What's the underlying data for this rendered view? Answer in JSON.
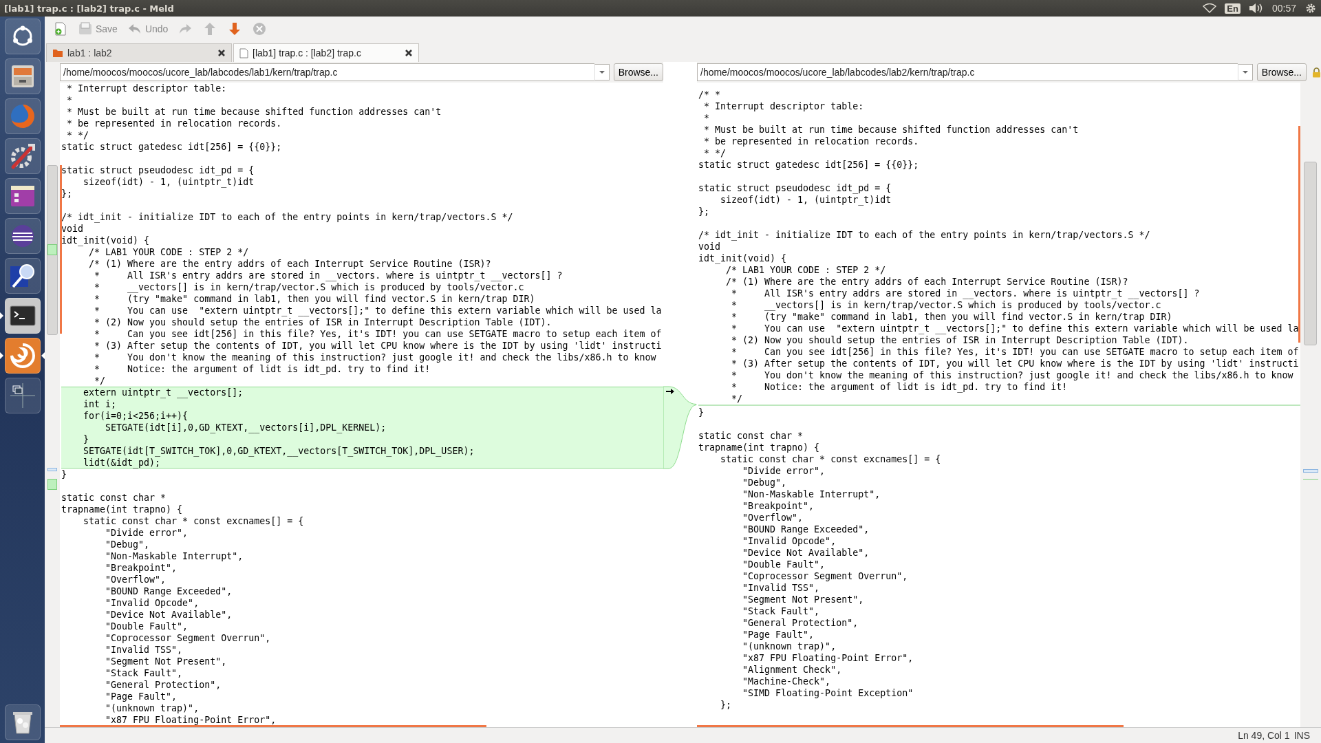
{
  "top_panel": {
    "title": "[lab1] trap.c : [lab2] trap.c - Meld",
    "keyboard": "En",
    "clock": "00:57"
  },
  "launcher": [
    {
      "kind": "dash",
      "running": false,
      "focused": false
    },
    {
      "kind": "files",
      "running": false,
      "focused": false
    },
    {
      "kind": "browser",
      "running": false,
      "focused": false
    },
    {
      "kind": "settings",
      "running": false,
      "focused": false
    },
    {
      "kind": "app",
      "running": false,
      "focused": false
    },
    {
      "kind": "sphere",
      "running": false,
      "focused": false
    },
    {
      "kind": "search",
      "running": false,
      "focused": false
    },
    {
      "kind": "terminal",
      "running": true,
      "focused": false
    },
    {
      "kind": "swirl",
      "running": true,
      "focused": true
    },
    {
      "kind": "workspaces",
      "running": false,
      "focused": false
    },
    {
      "kind": "trash",
      "running": false,
      "focused": false
    }
  ],
  "toolbar": [
    {
      "kind": "new",
      "disabled": false
    },
    {
      "kind": "save",
      "label": "Save",
      "disabled": true
    },
    {
      "kind": "undo",
      "label": "Undo",
      "disabled": true
    },
    {
      "kind": "redo",
      "disabled": true
    },
    {
      "kind": "up",
      "disabled": true
    },
    {
      "kind": "down",
      "disabled": false
    },
    {
      "kind": "stop",
      "disabled": true
    }
  ],
  "tabs": [
    {
      "label": "lab1 : lab2",
      "kind": "folder",
      "selected": false
    },
    {
      "label": "[lab1] trap.c : [lab2] trap.c",
      "kind": "file",
      "selected": true
    }
  ],
  "panes": [
    {
      "path": "/home/moocos/moocos/ucore_lab/labcodes/lab1/kern/trap/trap.c",
      "browse": "Browse...",
      "locked": false,
      "blocks": [
        {
          "kind": "context",
          "lines": [
            " * Interrupt descriptor table:",
            " *",
            " * Must be built at run time because shifted function addresses can't",
            " * be represented in relocation records.",
            " * */",
            "static struct gatedesc idt[256] = {{0}};"
          ]
        },
        {
          "kind": "blank"
        },
        {
          "kind": "context",
          "lines": [
            "static struct pseudodesc idt_pd = {",
            "    sizeof(idt) - 1, (uintptr_t)idt",
            "};"
          ]
        },
        {
          "kind": "blank"
        },
        {
          "kind": "context",
          "lines": [
            "/* idt_init - initialize IDT to each of the entry points in kern/trap/vectors.S */",
            "void",
            "idt_init(void) {",
            "     /* LAB1 YOUR CODE : STEP 2 */",
            "     /* (1) Where are the entry addrs of each Interrupt Service Routine (ISR)?",
            "      *     All ISR's entry addrs are stored in __vectors. where is uintptr_t __vectors[] ?",
            "      *     __vectors[] is in kern/trap/vector.S which is produced by tools/vector.c",
            "      *     (try \"make\" command in lab1, then you will find vector.S in kern/trap DIR)",
            "      *     You can use  \"extern uintptr_t __vectors[];\" to define this extern variable which will be used la",
            "      * (2) Now you should setup the entries of ISR in Interrupt Description Table (IDT).",
            "      *     Can you see idt[256] in this file? Yes, it's IDT! you can use SETGATE macro to setup each item of",
            "      * (3) After setup the contents of IDT, you will let CPU know where is the IDT by using 'lidt' instructi",
            "      *     You don't know the meaning of this instruction? just google it! and check the libs/x86.h to know",
            "      *     Notice: the argument of lidt is idt_pd. try to find it!",
            "      */"
          ]
        },
        {
          "kind": "inserted",
          "lines": [
            "    extern uintptr_t __vectors[];",
            "    int i;",
            "    for(i=0;i<256;i++){",
            "        SETGATE(idt[i],0,GD_KTEXT,__vectors[i],DPL_KERNEL);",
            "    }",
            "    SETGATE(idt[T_SWITCH_TOK],0,GD_KTEXT,__vectors[T_SWITCH_TOK],DPL_USER);",
            "    lidt(&idt_pd);"
          ]
        },
        {
          "kind": "context",
          "lines": [
            "}"
          ]
        },
        {
          "kind": "blank"
        },
        {
          "kind": "context",
          "lines": [
            "static const char *",
            "trapname(int trapno) {",
            "    static const char * const excnames[] = {",
            "        \"Divide error\",",
            "        \"Debug\",",
            "        \"Non-Maskable Interrupt\",",
            "        \"Breakpoint\",",
            "        \"Overflow\",",
            "        \"BOUND Range Exceeded\",",
            "        \"Invalid Opcode\",",
            "        \"Device Not Available\",",
            "        \"Double Fault\",",
            "        \"Coprocessor Segment Overrun\",",
            "        \"Invalid TSS\",",
            "        \"Segment Not Present\",",
            "        \"Stack Fault\",",
            "        \"General Protection\",",
            "        \"Page Fault\",",
            "        \"(unknown trap)\",",
            "        \"x87 FPU Floating-Point Error\","
          ]
        }
      ]
    },
    {
      "path": "/home/moocos/moocos/ucore_lab/labcodes/lab2/kern/trap/trap.c",
      "browse": "Browse...",
      "locked": true,
      "blocks": [
        {
          "kind": "context",
          "lines": [
            "/* *",
            " * Interrupt descriptor table:",
            " *",
            " * Must be built at run time because shifted function addresses can't",
            " * be represented in relocation records.",
            " * */",
            "static struct gatedesc idt[256] = {{0}};"
          ]
        },
        {
          "kind": "blank"
        },
        {
          "kind": "context",
          "lines": [
            "static struct pseudodesc idt_pd = {",
            "    sizeof(idt) - 1, (uintptr_t)idt",
            "};"
          ]
        },
        {
          "kind": "blank"
        },
        {
          "kind": "context",
          "lines": [
            "/* idt_init - initialize IDT to each of the entry points in kern/trap/vectors.S */",
            "void",
            "idt_init(void) {",
            "     /* LAB1 YOUR CODE : STEP 2 */",
            "     /* (1) Where are the entry addrs of each Interrupt Service Routine (ISR)?",
            "      *     All ISR's entry addrs are stored in __vectors. where is uintptr_t __vectors[] ?",
            "      *     __vectors[] is in kern/trap/vector.S which is produced by tools/vector.c",
            "      *     (try \"make\" command in lab1, then you will find vector.S in kern/trap DIR)",
            "      *     You can use  \"extern uintptr_t __vectors[];\" to define this extern variable which will be used la",
            "      * (2) Now you should setup the entries of ISR in Interrupt Description Table (IDT).",
            "      *     Can you see idt[256] in this file? Yes, it's IDT! you can use SETGATE macro to setup each item of",
            "      * (3) After setup the contents of IDT, you will let CPU know where is the IDT by using 'lidt' instructi",
            "      *     You don't know the meaning of this instruction? just google it! and check the libs/x86.h to know",
            "      *     Notice: the argument of lidt is idt_pd. try to find it!",
            "      */"
          ]
        },
        {
          "kind": "gap"
        },
        {
          "kind": "context",
          "lines": [
            "}"
          ]
        },
        {
          "kind": "blank"
        },
        {
          "kind": "context",
          "lines": [
            "static const char *",
            "trapname(int trapno) {",
            "    static const char * const excnames[] = {",
            "        \"Divide error\",",
            "        \"Debug\",",
            "        \"Non-Maskable Interrupt\",",
            "        \"Breakpoint\",",
            "        \"Overflow\",",
            "        \"BOUND Range Exceeded\",",
            "        \"Invalid Opcode\",",
            "        \"Device Not Available\",",
            "        \"Double Fault\",",
            "        \"Coprocessor Segment Overrun\",",
            "        \"Invalid TSS\",",
            "        \"Segment Not Present\",",
            "        \"Stack Fault\",",
            "        \"General Protection\",",
            "        \"Page Fault\",",
            "        \"(unknown trap)\",",
            "        \"x87 FPU Floating-Point Error\",",
            "        \"Alignment Check\",",
            "        \"Machine-Check\",",
            "        \"SIMD Floating-Point Exception\"",
            "    };"
          ]
        }
      ]
    }
  ],
  "status_bar": {
    "position": "Ln 49, Col 1",
    "mode": "INS"
  }
}
